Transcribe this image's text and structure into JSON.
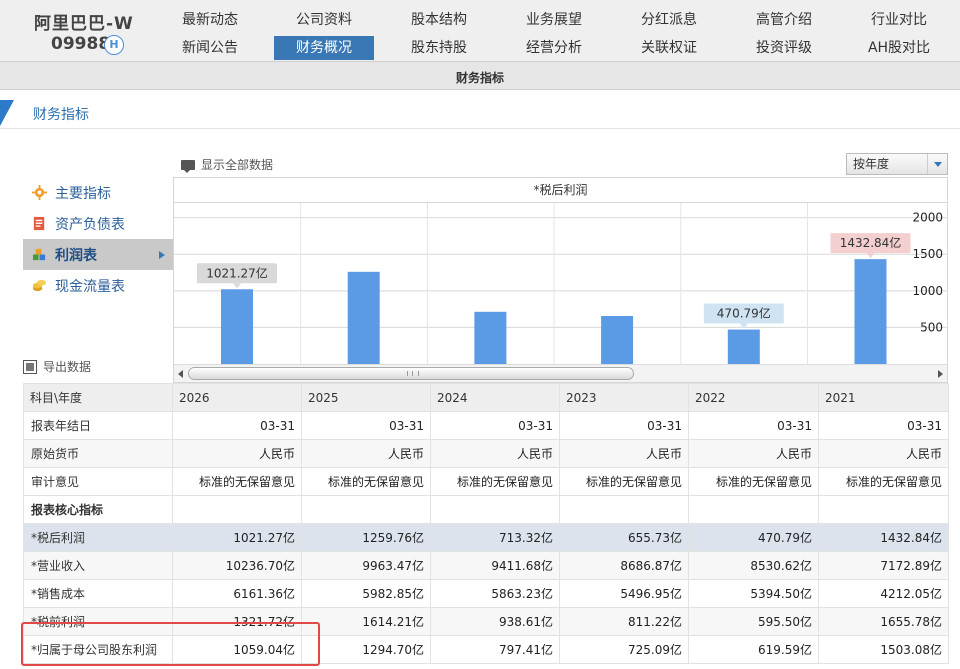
{
  "stock": {
    "name": "阿里巴巴-W",
    "code": "09988",
    "market_badge": "H"
  },
  "nav": {
    "row1": [
      "最新动态",
      "公司资料",
      "股本结构",
      "业务展望",
      "分红派息",
      "高管介绍",
      "行业对比"
    ],
    "row2": [
      "新闻公告",
      "财务概况",
      "股东持股",
      "经营分析",
      "关联权证",
      "投资评级",
      "AH股对比"
    ],
    "active": "财务概况"
  },
  "subnav": {
    "label": "财务指标"
  },
  "section": {
    "title": "财务指标"
  },
  "controls": {
    "show_all_label": "显示全部数据",
    "period_select": "按年度"
  },
  "left_menu": [
    {
      "label": "主要指标",
      "icon": "gear-icon"
    },
    {
      "label": "资产负债表",
      "icon": "document-icon"
    },
    {
      "label": "利润表",
      "icon": "cubes-icon",
      "active": true
    },
    {
      "label": "现金流量表",
      "icon": "coins-icon"
    }
  ],
  "export_label": "导出数据",
  "chart_data": {
    "type": "bar",
    "title": "*税后利润",
    "categories": [
      "2026",
      "2025",
      "2024",
      "2023",
      "2022",
      "2021"
    ],
    "values": [
      1021.27,
      1259.76,
      713.32,
      655.73,
      470.79,
      1432.84
    ],
    "yticks": [
      500,
      1000,
      1500,
      2000
    ],
    "ylim": [
      0,
      2200
    ],
    "callouts": [
      {
        "index": 0,
        "label": "1021.27亿",
        "color": "#d9d9d9"
      },
      {
        "index": 4,
        "label": "470.79亿",
        "color": "#cfe3f3"
      },
      {
        "index": 5,
        "label": "1432.84亿",
        "color": "#f3cfcf"
      }
    ],
    "bar_color": "#5b9be6",
    "grid": true
  },
  "table": {
    "header": [
      "科目\\年度",
      "2026",
      "2025",
      "2024",
      "2023",
      "2022",
      "2021"
    ],
    "rows": [
      {
        "label": "报表年结日",
        "values": [
          "03-31",
          "03-31",
          "03-31",
          "03-31",
          "03-31",
          "03-31"
        ]
      },
      {
        "label": "原始货币",
        "values": [
          "人民币",
          "人民币",
          "人民币",
          "人民币",
          "人民币",
          "人民币"
        ]
      },
      {
        "label": "审计意见",
        "values": [
          "标准的无保留意见",
          "标准的无保留意见",
          "标准的无保留意见",
          "标准的无保留意见",
          "标准的无保留意见",
          "标准的无保留意见"
        ]
      },
      {
        "label": "报表核心指标",
        "values": [
          "",
          "",
          "",
          "",
          "",
          ""
        ],
        "section": true
      },
      {
        "label": "*税后利润",
        "values": [
          "1021.27亿",
          "1259.76亿",
          "713.32亿",
          "655.73亿",
          "470.79亿",
          "1432.84亿"
        ],
        "highlight": true
      },
      {
        "label": "*营业收入",
        "values": [
          "10236.70亿",
          "9963.47亿",
          "9411.68亿",
          "8686.87亿",
          "8530.62亿",
          "7172.89亿"
        ]
      },
      {
        "label": "*销售成本",
        "values": [
          "6161.36亿",
          "5982.85亿",
          "5863.23亿",
          "5496.95亿",
          "5394.50亿",
          "4212.05亿"
        ]
      },
      {
        "label": "*税前利润",
        "values": [
          "1321.72亿",
          "1614.21亿",
          "938.61亿",
          "811.22亿",
          "595.50亿",
          "1655.78亿"
        ]
      },
      {
        "label": "*归属于母公司股东利润",
        "values": [
          "1059.04亿",
          "1294.70亿",
          "797.41亿",
          "725.09亿",
          "619.59亿",
          "1503.08亿"
        ]
      }
    ]
  }
}
